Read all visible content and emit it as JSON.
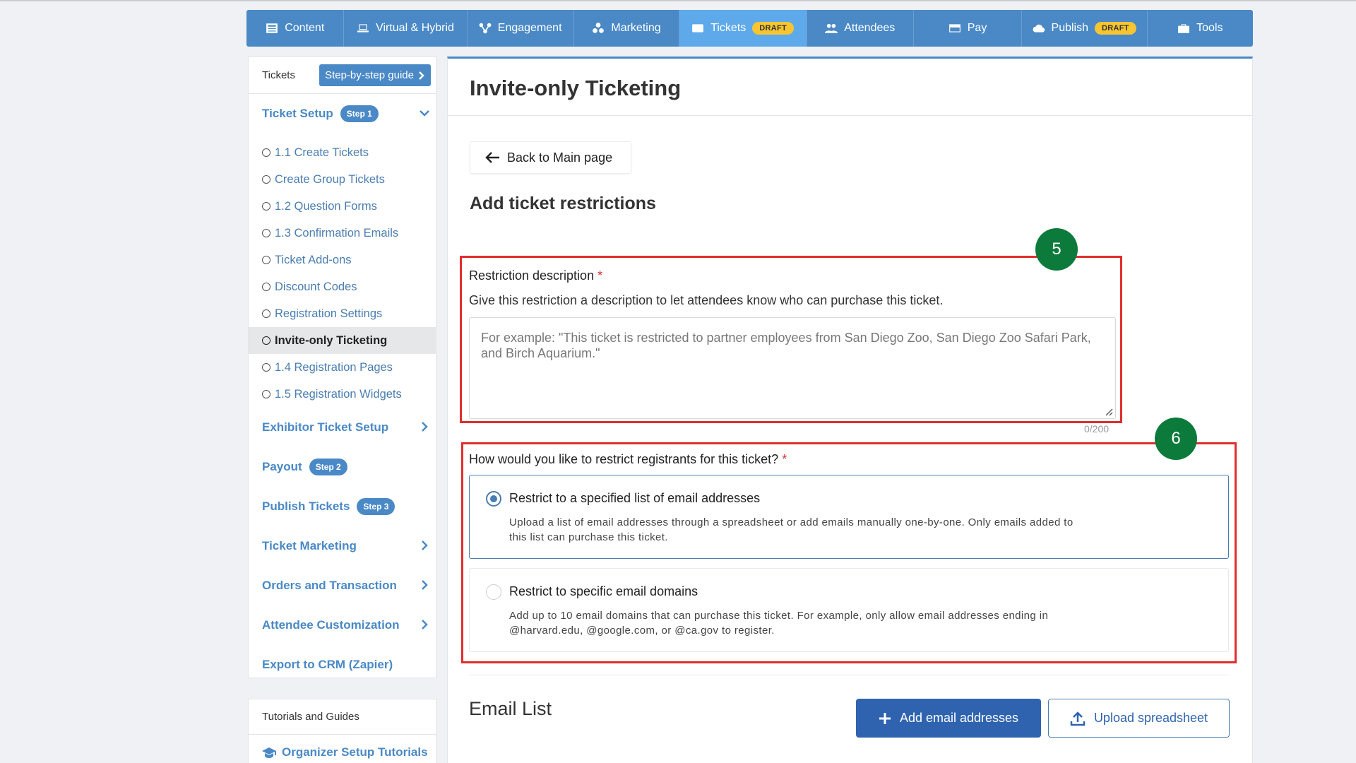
{
  "topnav": {
    "items": [
      {
        "label": "Content",
        "icon": "content-icon"
      },
      {
        "label": "Virtual & Hybrid",
        "icon": "laptop-icon"
      },
      {
        "label": "Engagement",
        "icon": "engagement-icon"
      },
      {
        "label": "Marketing",
        "icon": "marketing-icon"
      },
      {
        "label": "Tickets",
        "icon": "ticket-icon",
        "badge": "DRAFT",
        "active": true
      },
      {
        "label": "Attendees",
        "icon": "attendees-icon"
      },
      {
        "label": "Pay",
        "icon": "credit-card-icon"
      },
      {
        "label": "Publish",
        "icon": "cloud-upload-icon",
        "badge": "DRAFT"
      },
      {
        "label": "Tools",
        "icon": "toolbox-icon"
      }
    ]
  },
  "sidebar": {
    "header_label": "Tickets",
    "guide_button": "Step-by-step guide",
    "ticket_setup": {
      "label": "Ticket Setup",
      "step": "Step 1"
    },
    "items": [
      {
        "label": "1.1 Create Tickets"
      },
      {
        "label": "Create Group Tickets"
      },
      {
        "label": "1.2 Question Forms"
      },
      {
        "label": "1.3 Confirmation Emails"
      },
      {
        "label": "Ticket Add-ons"
      },
      {
        "label": "Discount Codes"
      },
      {
        "label": "Registration Settings"
      },
      {
        "label": "Invite-only Ticketing",
        "active": true
      },
      {
        "label": "1.4 Registration Pages"
      },
      {
        "label": "1.5 Registration Widgets"
      }
    ],
    "exhibitor": "Exhibitor Ticket Setup",
    "payout": {
      "label": "Payout",
      "step": "Step 2"
    },
    "publish_tickets": {
      "label": "Publish Tickets",
      "step": "Step 3"
    },
    "ticket_marketing": "Ticket Marketing",
    "orders": "Orders and Transaction",
    "attendee_customization": "Attendee Customization",
    "export_crm": "Export to CRM (Zapier)",
    "tutorials_header": "Tutorials and Guides",
    "tutorials_link": "Organizer Setup Tutorials"
  },
  "main": {
    "page_title": "Invite-only Ticketing",
    "back_button": "Back to Main page",
    "section_title": "Add ticket restrictions",
    "restriction_label": "Restriction description",
    "required_mark": "*",
    "restriction_help": "Give this restriction a description to let attendees know who can purchase this ticket.",
    "restriction_placeholder": "For example: \"This ticket is restricted to partner employees from San Diego Zoo, San Diego Zoo Safari Park, and Birch Aquarium.\"",
    "counter": "0/200",
    "restrict_question": "How would you like to restrict registrants for this ticket?",
    "options": [
      {
        "title": "Restrict to a specified list of email addresses",
        "desc": "Upload a list of email addresses through a spreadsheet or add emails manually one-by-one. Only emails added to this list can purchase this ticket.",
        "selected": true
      },
      {
        "title": "Restrict to specific email domains",
        "desc": "Add up to 10 email domains that can purchase this ticket. For example, only allow email addresses ending in @harvard.edu, @google.com, or @ca.gov to register.",
        "selected": false
      }
    ],
    "email_list_title": "Email List",
    "add_emails_button": "Add email addresses",
    "upload_button": "Upload spreadsheet"
  },
  "annotations": {
    "step5": "5",
    "step6": "6"
  },
  "colors": {
    "nav_bg": "#4a89c6",
    "nav_active": "#5ea9ea",
    "badge": "#f6c531",
    "highlight": "#e02d2d",
    "annotation": "#0c7a3b",
    "primary_button": "#2f63b0"
  }
}
